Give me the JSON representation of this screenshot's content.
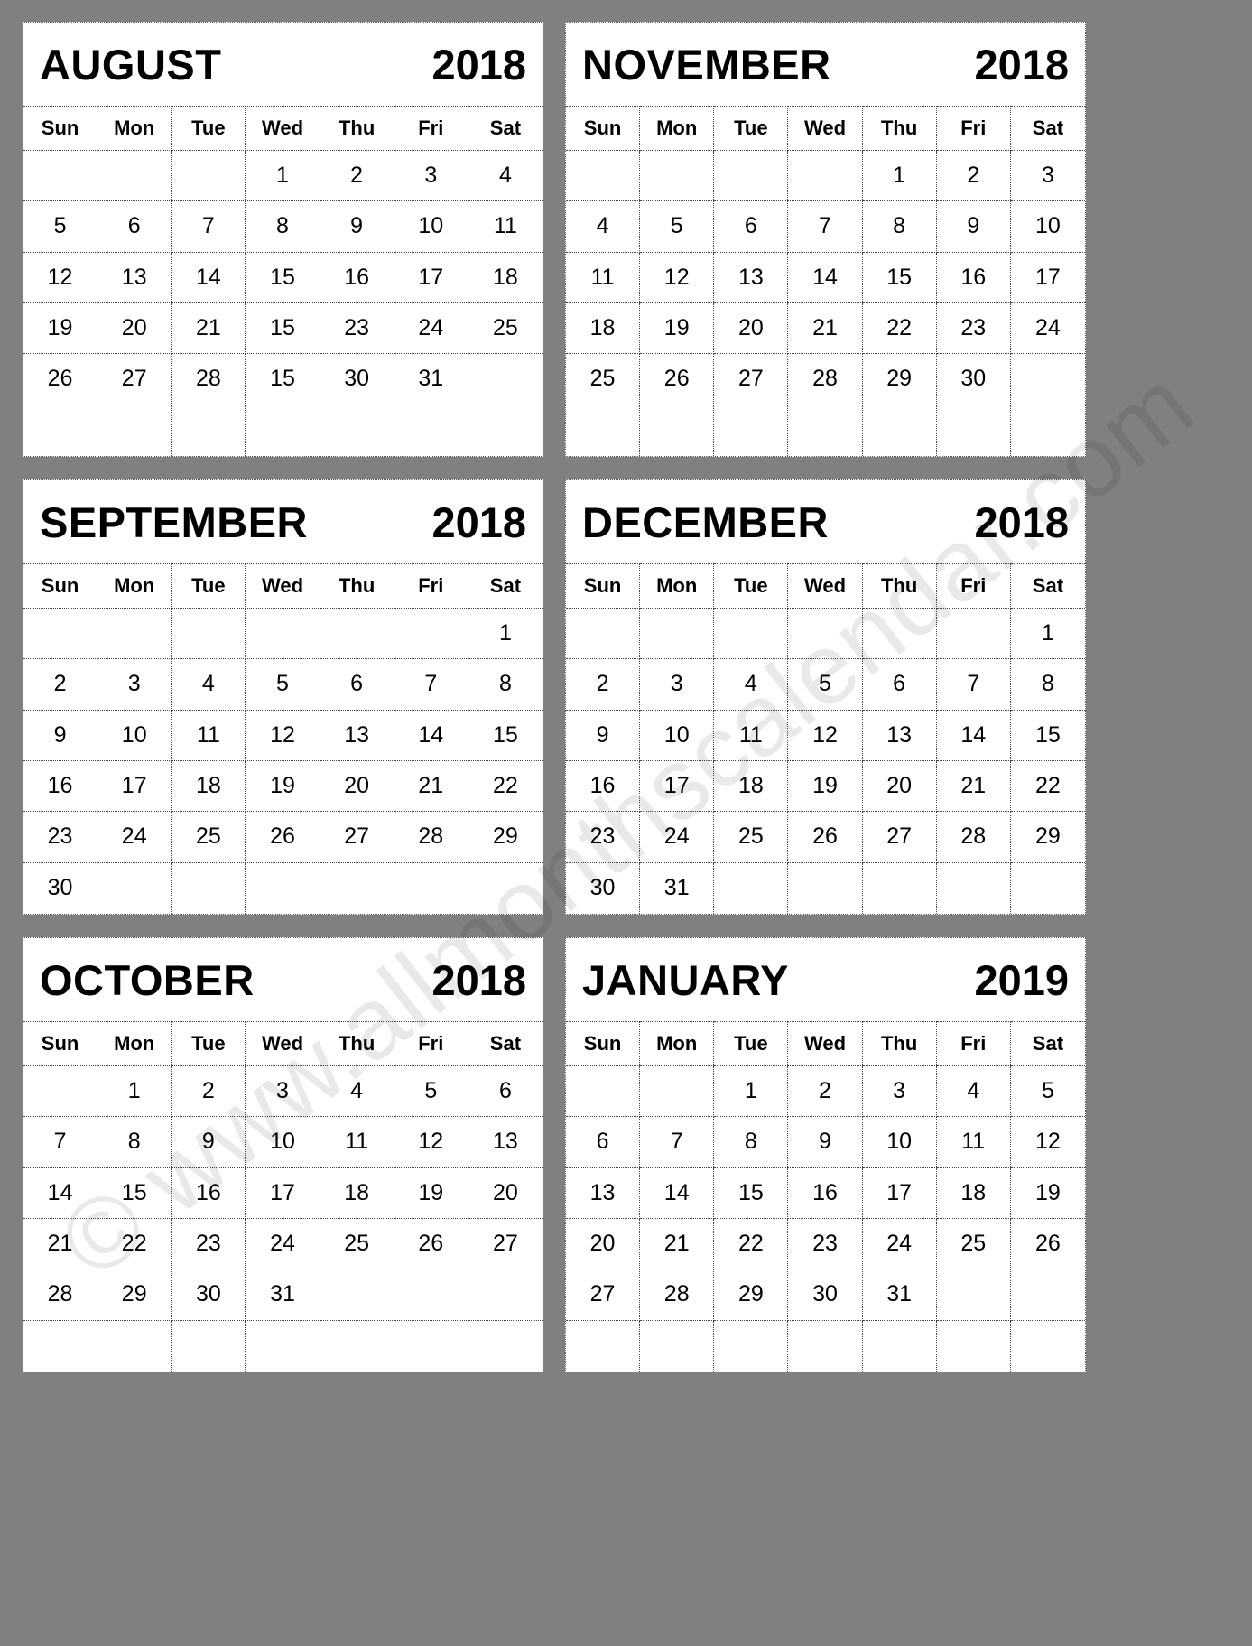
{
  "watermark": {
    "text": "© www.allmonthscalendar.com"
  },
  "colors": {
    "page_background": "#808080",
    "panel_background": "#ffffff",
    "text": "#000000",
    "grid_line": "#444444"
  },
  "weekday_headers": [
    "Sun",
    "Mon",
    "Tue",
    "Wed",
    "Thu",
    "Fri",
    "Sat"
  ],
  "months": [
    {
      "name": "AUGUST",
      "year": "2018",
      "weeks": [
        [
          "",
          "",
          "",
          "1",
          "2",
          "3",
          "4"
        ],
        [
          "5",
          "6",
          "7",
          "8",
          "9",
          "10",
          "11"
        ],
        [
          "12",
          "13",
          "14",
          "15",
          "16",
          "17",
          "18"
        ],
        [
          "19",
          "20",
          "21",
          "15",
          "23",
          "24",
          "25"
        ],
        [
          "26",
          "27",
          "28",
          "15",
          "30",
          "31",
          ""
        ],
        [
          "",
          "",
          "",
          "",
          "",
          "",
          ""
        ]
      ]
    },
    {
      "name": "NOVEMBER",
      "year": "2018",
      "weeks": [
        [
          "",
          "",
          "",
          "",
          "1",
          "2",
          "3"
        ],
        [
          "4",
          "5",
          "6",
          "7",
          "8",
          "9",
          "10"
        ],
        [
          "11",
          "12",
          "13",
          "14",
          "15",
          "16",
          "17"
        ],
        [
          "18",
          "19",
          "20",
          "21",
          "22",
          "23",
          "24"
        ],
        [
          "25",
          "26",
          "27",
          "28",
          "29",
          "30",
          ""
        ],
        [
          "",
          "",
          "",
          "",
          "",
          "",
          ""
        ]
      ]
    },
    {
      "name": "SEPTEMBER",
      "year": "2018",
      "weeks": [
        [
          "",
          "",
          "",
          "",
          "",
          "",
          "1"
        ],
        [
          "2",
          "3",
          "4",
          "5",
          "6",
          "7",
          "8"
        ],
        [
          "9",
          "10",
          "11",
          "12",
          "13",
          "14",
          "15"
        ],
        [
          "16",
          "17",
          "18",
          "19",
          "20",
          "21",
          "22"
        ],
        [
          "23",
          "24",
          "25",
          "26",
          "27",
          "28",
          "29"
        ],
        [
          "30",
          "",
          "",
          "",
          "",
          "",
          ""
        ]
      ]
    },
    {
      "name": "DECEMBER",
      "year": "2018",
      "weeks": [
        [
          "",
          "",
          "",
          "",
          "",
          "",
          "1"
        ],
        [
          "2",
          "3",
          "4",
          "5",
          "6",
          "7",
          "8"
        ],
        [
          "9",
          "10",
          "11",
          "12",
          "13",
          "14",
          "15"
        ],
        [
          "16",
          "17",
          "18",
          "19",
          "20",
          "21",
          "22"
        ],
        [
          "23",
          "24",
          "25",
          "26",
          "27",
          "28",
          "29"
        ],
        [
          "30",
          "31",
          "",
          "",
          "",
          "",
          ""
        ]
      ]
    },
    {
      "name": "OCTOBER",
      "year": "2018",
      "weeks": [
        [
          "",
          "1",
          "2",
          "3",
          "4",
          "5",
          "6"
        ],
        [
          "7",
          "8",
          "9",
          "10",
          "11",
          "12",
          "13"
        ],
        [
          "14",
          "15",
          "16",
          "17",
          "18",
          "19",
          "20"
        ],
        [
          "21",
          "22",
          "23",
          "24",
          "25",
          "26",
          "27"
        ],
        [
          "28",
          "29",
          "30",
          "31",
          "",
          "",
          ""
        ],
        [
          "",
          "",
          "",
          "",
          "",
          "",
          ""
        ]
      ]
    },
    {
      "name": "JANUARY",
      "year": "2019",
      "weeks": [
        [
          "",
          "",
          "1",
          "2",
          "3",
          "4",
          "5"
        ],
        [
          "6",
          "7",
          "8",
          "9",
          "10",
          "11",
          "12"
        ],
        [
          "13",
          "14",
          "15",
          "16",
          "17",
          "18",
          "19"
        ],
        [
          "20",
          "21",
          "22",
          "23",
          "24",
          "25",
          "26"
        ],
        [
          "27",
          "28",
          "29",
          "30",
          "31",
          "",
          ""
        ],
        [
          "",
          "",
          "",
          "",
          "",
          "",
          ""
        ]
      ]
    }
  ]
}
